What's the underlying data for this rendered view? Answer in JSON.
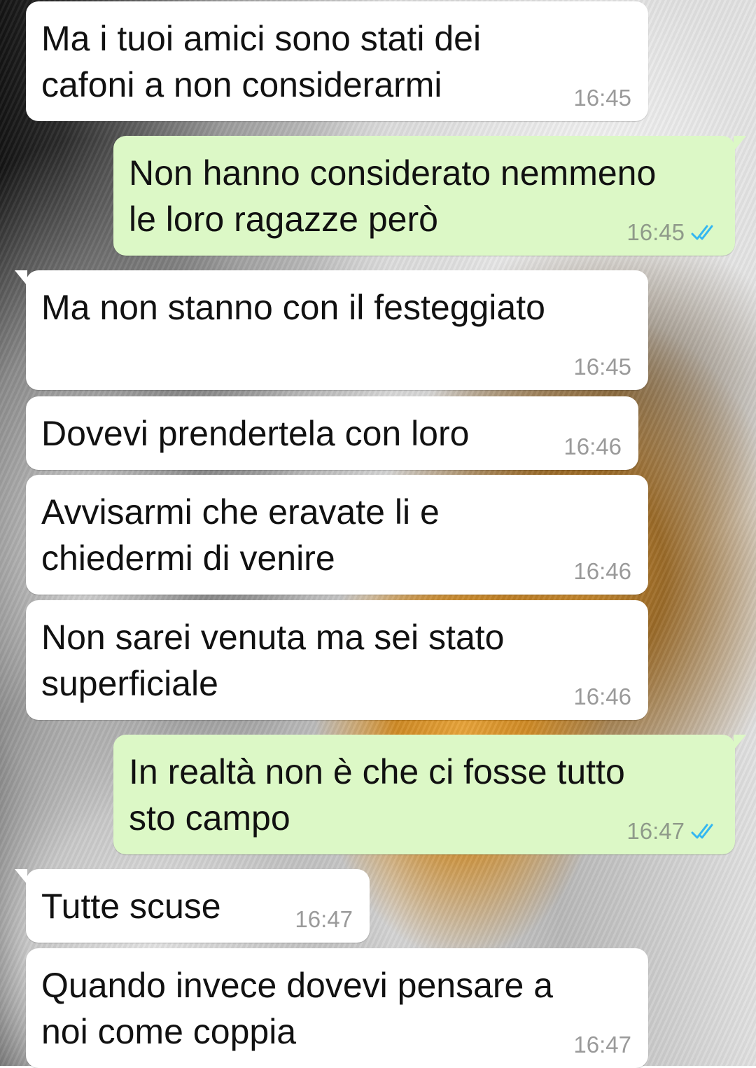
{
  "colors": {
    "incoming_bubble": "#ffffff",
    "outgoing_bubble": "#dcf8c6",
    "read_ticks": "#34b7f1"
  },
  "messages": [
    {
      "direction": "in",
      "text": "Ma i tuoi amici sono stati dei\ncafoni a non considerarmi",
      "time": "16:45"
    },
    {
      "direction": "out",
      "text": "Non hanno considerato nemmeno\nle loro ragazze però",
      "time": "16:45",
      "status": "read-ticks-icon"
    },
    {
      "direction": "in",
      "text": "Ma non stanno con il festeggiato",
      "time": "16:45"
    },
    {
      "direction": "in",
      "text": "Dovevi prendertela con loro",
      "time": "16:46"
    },
    {
      "direction": "in",
      "text": "Avvisarmi che eravate li e\nchiedermi di venire",
      "time": "16:46"
    },
    {
      "direction": "in",
      "text": "Non sarei venuta ma sei stato\nsuperficiale",
      "time": "16:46"
    },
    {
      "direction": "out",
      "text": "In realtà non è che ci fosse tutto\nsto campo",
      "time": "16:47",
      "status": "read-ticks-icon"
    },
    {
      "direction": "in",
      "text": "Tutte scuse",
      "time": "16:47"
    },
    {
      "direction": "in",
      "text": "Quando invece dovevi pensare a\nnoi come coppia",
      "time": "16:47"
    }
  ]
}
